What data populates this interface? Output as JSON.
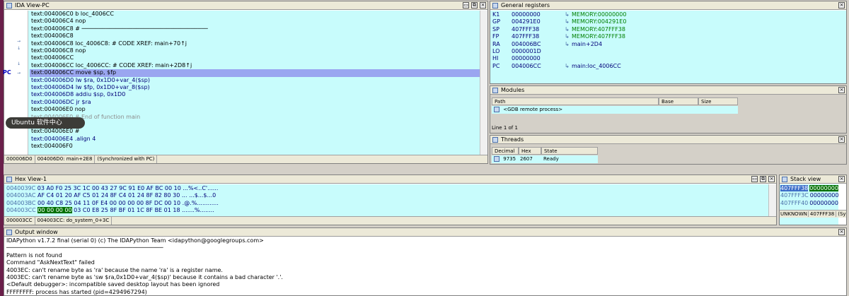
{
  "ida_view": {
    "title": "IDA View-PC",
    "lines": [
      {
        "text": "text:004006C0 b      loc_4006CC",
        "style": "addr"
      },
      {
        "text": "text:004006C4 nop",
        "style": "addr"
      },
      {
        "text": "text:004006C8 # ─────────────────────────────────────",
        "style": "addr"
      },
      {
        "text": "text:004006C8",
        "style": "addr"
      },
      {
        "text": "text:004006C8 loc_4006C8:                          # CODE XREF: main+70↑j",
        "style": "addr"
      },
      {
        "text": "text:004006C8 nop",
        "style": "addr"
      },
      {
        "text": "text:004006CC",
        "style": "addr"
      },
      {
        "text": "text:004006CC loc_4006CC:                           # CODE XREF: main+2D8↑j",
        "style": "addr"
      },
      {
        "text": "text:004006CC move    $sp, $fp",
        "style": "hl"
      },
      {
        "text": "text:004006D0 lw      $ra, 0x1D0+var_4($sp)",
        "style": "blue"
      },
      {
        "text": "text:004006D4 lw      $fp, 0x1D0+var_8($sp)",
        "style": "blue"
      },
      {
        "text": "text:004006D8 addiu   $sp, 0x1D0",
        "style": "blue"
      },
      {
        "text": "text:004006DC jr      $ra",
        "style": "blue"
      },
      {
        "text": "text:004006E0 nop",
        "style": "addr"
      },
      {
        "text": "text:004006E0 # End of function main",
        "style": "dim"
      },
      {
        "text": "",
        "style": "addr"
      },
      {
        "text": "text:004006E0 #",
        "style": "addr"
      },
      {
        "text": "text:004006E4 .align 4",
        "style": "blue"
      },
      {
        "text": "text:004006F0",
        "style": "addr"
      }
    ],
    "pc_label": "PC",
    "status": [
      "000006D0",
      "004006D0: main+2E8",
      "(Synchronized with PC)"
    ]
  },
  "registers": {
    "title": "General registers",
    "rows": [
      {
        "name": "K1",
        "value": "00000000",
        "desc": "MEMORY:00000000",
        "green": true
      },
      {
        "name": "GP",
        "value": "004291E0",
        "desc": "MEMORY:004291E0",
        "green": true
      },
      {
        "name": "SP",
        "value": "407FFF38",
        "desc": "MEMORY:407FFF38",
        "green": true
      },
      {
        "name": "FP",
        "value": "407FFF38",
        "desc": "MEMORY:407FFF38",
        "green": true
      },
      {
        "name": "RA",
        "value": "004006BC",
        "desc": "main+2D4",
        "green": false
      },
      {
        "name": "LO",
        "value": "0000001D",
        "desc": "",
        "green": false
      },
      {
        "name": "HI",
        "value": "00000000",
        "desc": "",
        "green": false
      },
      {
        "name": "PC",
        "value": "004006CC",
        "desc": "main:loc_4006CC",
        "green": false
      }
    ]
  },
  "modules": {
    "title": "Modules",
    "headers": [
      "Path",
      "Base",
      "Size"
    ],
    "rows": [
      {
        "path": "<GDB remote process>",
        "base": "",
        "size": ""
      }
    ],
    "status": "Line 1 of 1"
  },
  "threads": {
    "title": "Threads",
    "headers": [
      "Decimal",
      "Hex",
      "State"
    ],
    "rows": [
      {
        "decimal": "9735",
        "hex": "2607",
        "state": "Ready"
      }
    ]
  },
  "hex_view": {
    "title": "Hex View-1",
    "lines": [
      {
        "addr": "0040039C",
        "bytes": "03 A0 F0 25 3C 1C 00 43  27 9C 91 E0 AF BC 00 10",
        "ascii": "...%<..C'......"
      },
      {
        "addr": "004003AC",
        "bytes": "AF C4 01 20 AF C5 01 24  8F C4 01 24 8F 82 80 30",
        "ascii": "... ...$...$...0"
      },
      {
        "addr": "004003BC",
        "bytes": "00 40 C8 25 04 11 0F E4  00 00 00 00 8F DC 00 10",
        "ascii": ".@.%............"
      },
      {
        "addr": "004003CC",
        "sel": "00 00 00 00",
        "bytes": "03 C0 E8 25  8F BF 01 1C 8F BE 01 18",
        "ascii": ".......%........"
      }
    ],
    "status": [
      "000003CC",
      "004003CC: do_system_0+3C"
    ]
  },
  "stack_view": {
    "title": "Stack view",
    "rows": [
      {
        "addr": "407FFF38",
        "val": "00000000",
        "sel": true
      },
      {
        "addr": "407FFF3C",
        "val": "00000000",
        "sel": false
      },
      {
        "addr": "407FFF40",
        "val": "00000000",
        "sel": false
      }
    ],
    "status": [
      "UNKNOWN",
      "407FFF38",
      "(Synch"
    ]
  },
  "output": {
    "title": "Output window",
    "lines": [
      "IDAPython v1.7.2 final (serial 0) (c) The IDAPython Team <idapython@googlegroups.com>",
      "──────────────────────────────────────────────",
      "Pattern is not found",
      "Command \"AskNextText\" failed",
      "4003EC: can't rename byte as 'ra' because the name 'ra' is a register name.",
      "4003EC: can't rename byte as 'sw  $ra,0x1D0+var_4($sp)' because it contains a bad character '.'.",
      "<Default debugger>: incompatible saved desktop layout has been ignored",
      "FFFFFFFF: process  has started (pid=4294967294)"
    ]
  },
  "tooltip": "Ubuntu 软件中心",
  "colors": {
    "code_bg": "#c8fcfc",
    "highlight": "#9aa6f0",
    "launcher": "#6a1f4a"
  }
}
